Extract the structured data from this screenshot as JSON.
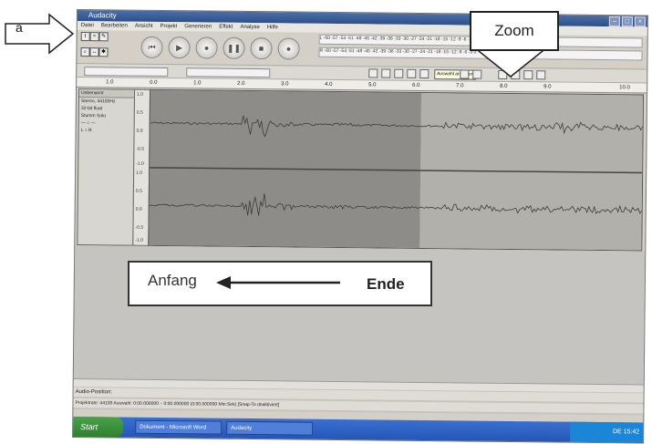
{
  "window": {
    "title": "Audacity",
    "menu": [
      "Datei",
      "Bearbeiten",
      "Ansicht",
      "Projekt",
      "Generieren",
      "Effekt",
      "Analyse",
      "Hilfe"
    ],
    "controls": [
      "–",
      "□",
      "×"
    ]
  },
  "toolbar": {
    "transport_icons": [
      "skip-start-icon",
      "play-icon",
      "loop-icon",
      "pause-icon",
      "stop-icon",
      "record-icon"
    ],
    "meter_left_label": "L",
    "meter_right_label": "R",
    "meter_scale": "-60 -57 -54 -51 -48 -45 -42 -39 -36 -33 -30 -27 -24 -21 -18 -15 -12 -9 -6 -3 0",
    "tooltip": "Auswahl anzeigen"
  },
  "ruler": {
    "ticks": [
      "1.0",
      "0.0",
      "1.0",
      "2.0",
      "3.0",
      "4.0",
      "5.0",
      "6.0",
      "7.0",
      "8.0",
      "9.0",
      "10.0"
    ]
  },
  "track": {
    "name": "Unbenannt",
    "info1": "Stereo, 44100Hz",
    "info2": "32-bit float",
    "mute": "Stumm",
    "solo": "Solo",
    "scale": [
      "1.0",
      "0.5",
      "0.0",
      "-0.5",
      "-1.0"
    ],
    "selection_fraction": 0.55
  },
  "status": {
    "line1": "Audio-Position:",
    "line2": "Projektrate: 44100    Auswahl: 0:00.000000 – 0:00.000000 (0:00.000000 Min:Sek)    [Snap-To deaktiviert]"
  },
  "taskbar": {
    "start": "Start",
    "tasks": [
      "Dokument - Microsoft Word",
      "Audacity"
    ],
    "clock": "DE  15:42"
  },
  "annotations": {
    "a_label": "a",
    "zoom_label": "Zoom",
    "start_label": "Anfang",
    "end_label": "Ende"
  }
}
